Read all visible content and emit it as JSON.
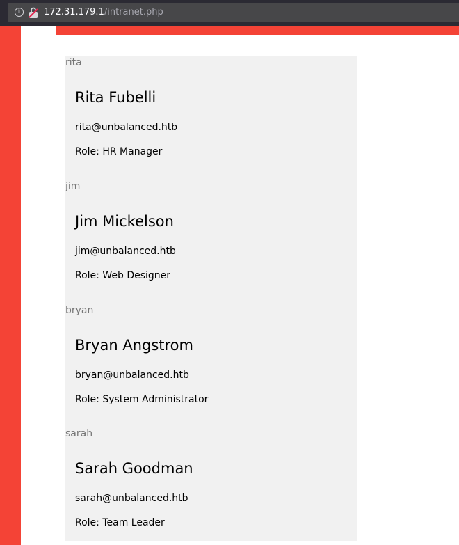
{
  "browser": {
    "url_host": "172.31.179.1",
    "url_path": "/intranet.php"
  },
  "employees": [
    {
      "username": "rita",
      "name": "Rita Fubelli",
      "email": "rita@unbalanced.htb",
      "role_prefix": "Role: ",
      "role": "HR Manager"
    },
    {
      "username": "jim",
      "name": "Jim Mickelson",
      "email": "jim@unbalanced.htb",
      "role_prefix": "Role: ",
      "role": "Web Designer"
    },
    {
      "username": "bryan",
      "name": "Bryan Angstrom",
      "email": "bryan@unbalanced.htb",
      "role_prefix": "Role: ",
      "role": "System Administrator"
    },
    {
      "username": "sarah",
      "name": "Sarah Goodman",
      "email": "sarah@unbalanced.htb",
      "role_prefix": "Role: ",
      "role": "Team Leader"
    }
  ],
  "colors": {
    "accent": "#f44336",
    "panel": "#f1f1f1"
  }
}
